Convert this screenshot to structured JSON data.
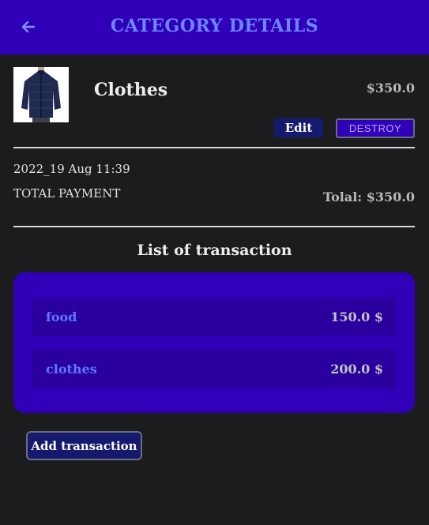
{
  "header": {
    "title": "CATEGORY DETAILS",
    "back_icon": "arrow-left-icon",
    "background": "#3000b8",
    "title_color": "#6b86ff"
  },
  "category": {
    "name": "Clothes",
    "amount": "$350.0",
    "image": "jacket-product-image",
    "edit_label": "Edit",
    "destroy_label": "DESTROY"
  },
  "summary": {
    "date": "2022_19 Aug 11:39",
    "payment_label": "TOTAL PAYMENT",
    "total": "Tolal: $350.0"
  },
  "transactions": {
    "title": "List of transaction",
    "items": [
      {
        "name": "food",
        "amount": "150.0 $"
      },
      {
        "name": "clothes",
        "amount": "200.0 $"
      }
    ]
  },
  "actions": {
    "add_label": "Add transaction"
  }
}
